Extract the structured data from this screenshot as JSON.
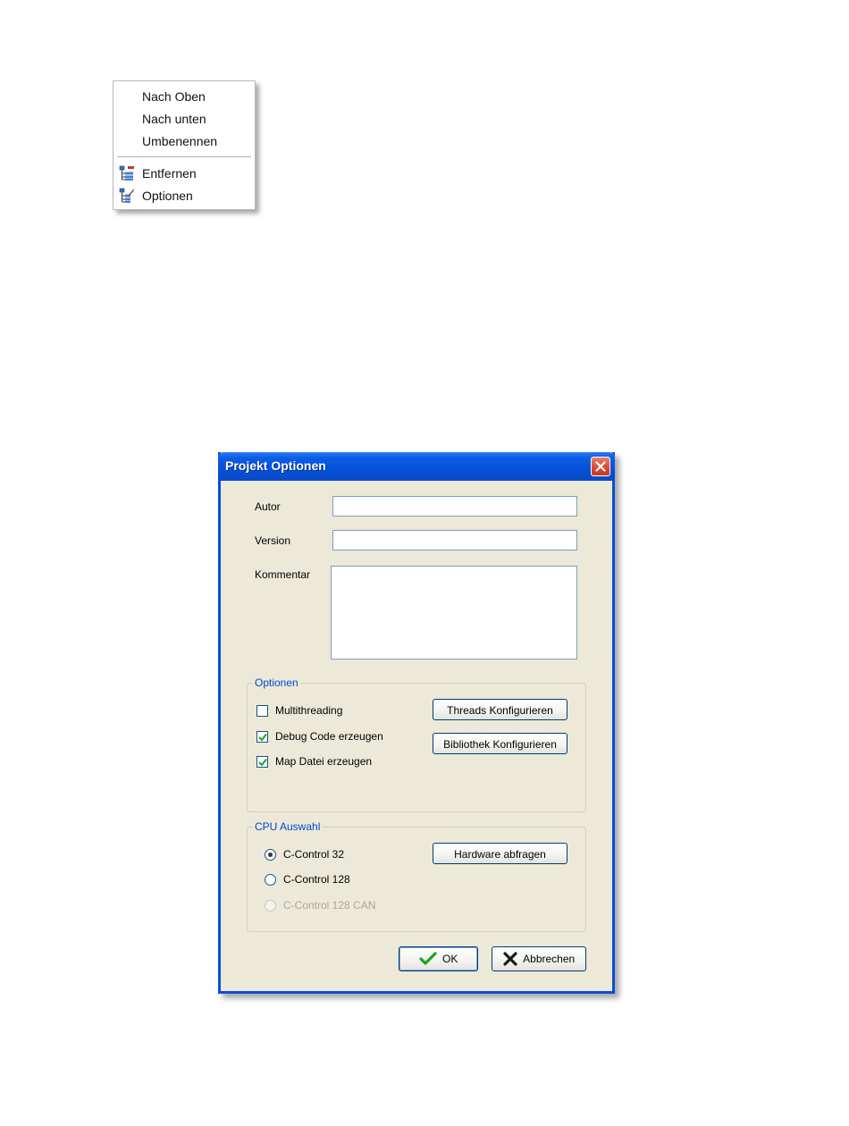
{
  "context_menu": {
    "items": [
      {
        "label": "Nach Oben",
        "icon": null
      },
      {
        "label": "Nach unten",
        "icon": null
      },
      {
        "label": "Umbenennen",
        "icon": null
      },
      {
        "label": "Entfernen",
        "icon": "tree-remove-icon"
      },
      {
        "label": "Optionen",
        "icon": "tree-options-icon"
      }
    ]
  },
  "dialog": {
    "title": "Projekt Optionen",
    "close_icon": "close-icon",
    "fields": {
      "autor_label": "Autor",
      "autor_value": "",
      "version_label": "Version",
      "version_value": "",
      "kommentar_label": "Kommentar",
      "kommentar_value": ""
    },
    "optionen_group": {
      "legend": "Optionen",
      "checkboxes": [
        {
          "label": "Multithreading",
          "checked": false
        },
        {
          "label": "Debug Code erzeugen",
          "checked": true
        },
        {
          "label": "Map Datei erzeugen",
          "checked": true
        }
      ],
      "threads_button": "Threads Konfigurieren",
      "bibliothek_button": "Bibliothek Konfigurieren"
    },
    "cpu_group": {
      "legend": "CPU Auswahl",
      "radios": [
        {
          "label": "C-Control 32",
          "selected": true,
          "enabled": true
        },
        {
          "label": "C-Control 128",
          "selected": false,
          "enabled": true
        },
        {
          "label": "C-Control 128 CAN",
          "selected": false,
          "enabled": false
        }
      ],
      "hardware_button": "Hardware abfragen"
    },
    "ok_button": "OK",
    "cancel_button": "Abbrechen",
    "colors": {
      "title_bar": "#0551d9",
      "dialog_bg": "#ece9d8",
      "group_legend": "#0046d5",
      "ok_check": "#21a121",
      "cancel_x": "#1a1a1a"
    }
  }
}
